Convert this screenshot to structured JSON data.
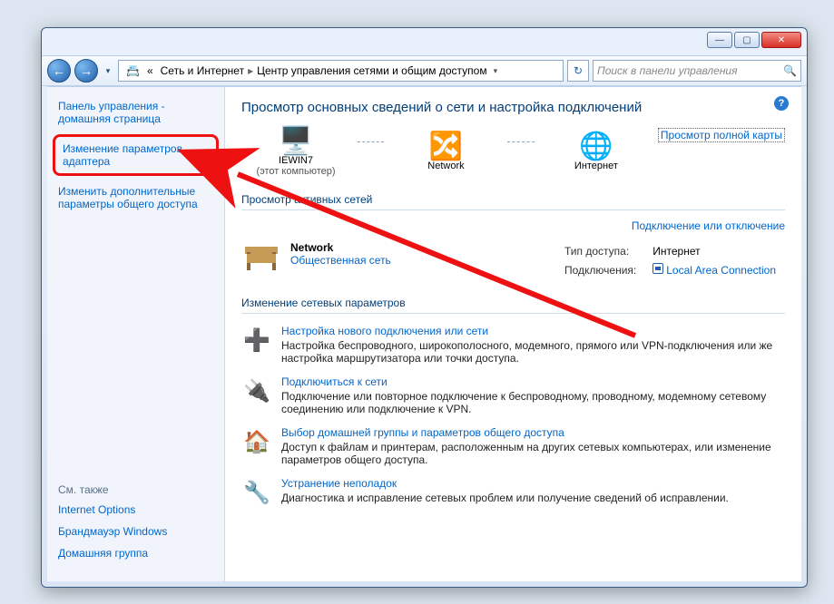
{
  "titlebar": {
    "minimize": "—",
    "maximize": "▢",
    "close": "✕"
  },
  "nav": {
    "back": "←",
    "forward": "→",
    "recent": "▾",
    "crumb_prefix": "«",
    "crumb1": "Сеть и Интернет",
    "crumb2": "Центр управления сетями и общим доступом",
    "refresh": "↻",
    "search_placeholder": "Поиск в панели управления",
    "search_icon": "🔍"
  },
  "sidebar": {
    "home": "Панель управления - домашняя страница",
    "adapter_settings": "Изменение параметров адаптера",
    "advanced_sharing": "Изменить дополнительные параметры общего доступа",
    "see_also": "См. также",
    "links": {
      "internet_options": "Internet Options",
      "firewall": "Брандмауэр Windows",
      "homegroup": "Домашняя группа"
    }
  },
  "content": {
    "help": "?",
    "title": "Просмотр основных сведений о сети и настройка подключений",
    "map": {
      "pc_icon": "🖥️",
      "pc_name": "IEWIN7",
      "pc_sub": "(этот компьютер)",
      "net_icon": "🔀",
      "net_name": "Network",
      "globe_icon": "🌐",
      "inet_name": "Интернет",
      "full_map": "Просмотр полной карты"
    },
    "active_networks_title": "Просмотр активных сетей",
    "connect_disconnect": "Подключение или отключение",
    "network": {
      "name": "Network",
      "type": "Общественная сеть"
    },
    "conn_labels": {
      "access_type": "Тип доступа:",
      "access_value": "Интернет",
      "connections": "Подключения:",
      "connection_link": "Local Area Connection"
    },
    "change_settings_title": "Изменение сетевых параметров",
    "tasks": [
      {
        "icon": "➕",
        "title": "Настройка нового подключения или сети",
        "desc": "Настройка беспроводного, широкополосного, модемного, прямого или VPN-подключения или же настройка маршрутизатора или точки доступа."
      },
      {
        "icon": "🔌",
        "title": "Подключиться к сети",
        "desc": "Подключение или повторное подключение к беспроводному, проводному, модемному сетевому соединению или подключение к VPN."
      },
      {
        "icon": "🏠",
        "title": "Выбор домашней группы и параметров общего доступа",
        "desc": "Доступ к файлам и принтерам, расположенным на других сетевых компьютерах, или изменение параметров общего доступа."
      },
      {
        "icon": "🔧",
        "title": "Устранение неполадок",
        "desc": "Диагностика и исправление сетевых проблем или получение сведений об исправлении."
      }
    ]
  }
}
